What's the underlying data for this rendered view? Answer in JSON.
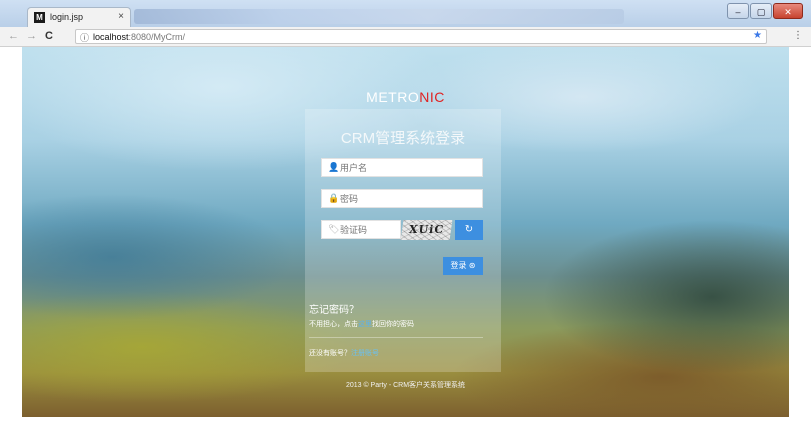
{
  "browser": {
    "tab_title": "login.jsp",
    "tab_favicon": "M",
    "tab_close": "×",
    "url_host": "localhost",
    "url_path": ":8080/MyCrm/",
    "bookmark_star": "★",
    "menu": "⋮",
    "window_controls": {
      "minimize": "–",
      "maximize": "▢",
      "close": "✕"
    },
    "nav": {
      "back": "←",
      "forward": "→",
      "reload": "C",
      "info": "ⓘ"
    }
  },
  "page": {
    "brand_part1": "METRO",
    "brand_part2": "NIC",
    "brand_color_accent": "#e02222",
    "login_title": "CRM管理系统登录",
    "username_placeholder": "用户名",
    "password_placeholder": "密码",
    "captcha_placeholder": "验证码",
    "captcha_text": "XUiC",
    "refresh_icon": "↻",
    "login_button": "登录 ⊛",
    "forgot_title": "忘记密码？",
    "forgot_desc_before": "不用担心，点击",
    "forgot_desc_link": "这里",
    "forgot_desc_after": "找回你的密码",
    "register_prompt": "还没有账号？",
    "register_link": "注册账号",
    "footer": "2013 © Party - CRM客户关系管理系统",
    "accent_color": "#3d8fe0"
  }
}
